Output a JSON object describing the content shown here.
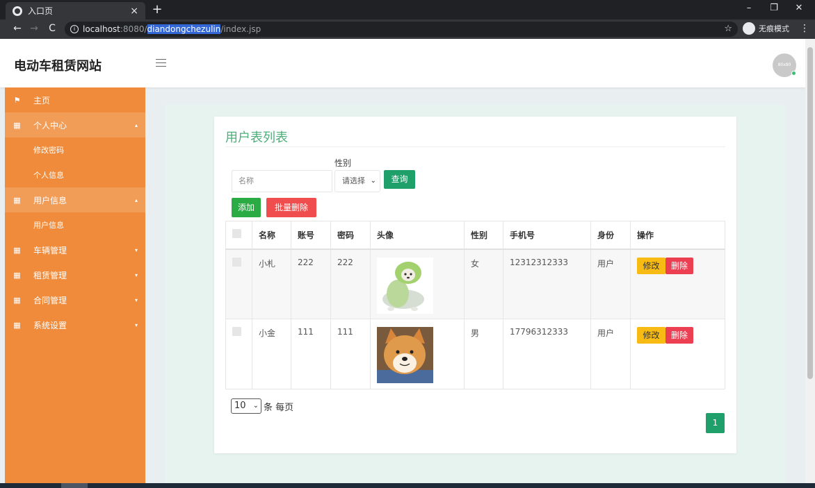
{
  "browser": {
    "tab_title": "入口页",
    "url_host": "localhost",
    "url_port": ":8080/",
    "url_selected": "diandongchezulin",
    "url_rest": "/index.jsp",
    "incognito_label": "无痕模式"
  },
  "header": {
    "site_title": "电动车租赁网站",
    "avatar_text": "80x80"
  },
  "sidebar": {
    "home": "主页",
    "personal_center": "个人中心",
    "change_password": "修改密码",
    "personal_info": "个人信息",
    "user_info": "用户信息",
    "user_info_sub": "用户信息",
    "vehicle_mgmt": "车辆管理",
    "rental_mgmt": "租赁管理",
    "contract_mgmt": "合同管理",
    "system_settings": "系统设置"
  },
  "main": {
    "title": "用户表列表",
    "search_placeholder": "名称",
    "gender_label": "性别",
    "gender_value": "请选择",
    "query_button": "查询",
    "add_button": "添加",
    "batch_delete_button": "批量删除",
    "columns": [
      "名称",
      "账号",
      "密码",
      "头像",
      "性别",
      "手机号",
      "身份",
      "操作"
    ],
    "rows": [
      {
        "name": "小札",
        "account": "222",
        "password": "222",
        "avatar": "cabbage-dog-photo",
        "gender": "女",
        "phone": "12312312333",
        "role": "用户"
      },
      {
        "name": "小金",
        "account": "111",
        "password": "111",
        "avatar": "shiba-dog-photo",
        "gender": "男",
        "phone": "17796312333",
        "role": "用户"
      }
    ],
    "edit_label": "修改",
    "delete_label": "删除",
    "page_size": "10",
    "page_size_suffix": "条 每页",
    "current_page": "1"
  },
  "colors": {
    "sidebar": "#ef8b3a",
    "accent_green": "#1f9f6a",
    "title_green": "#4caf7a",
    "edit_yellow": "#f8bb14",
    "delete_red": "#ec3f51"
  }
}
